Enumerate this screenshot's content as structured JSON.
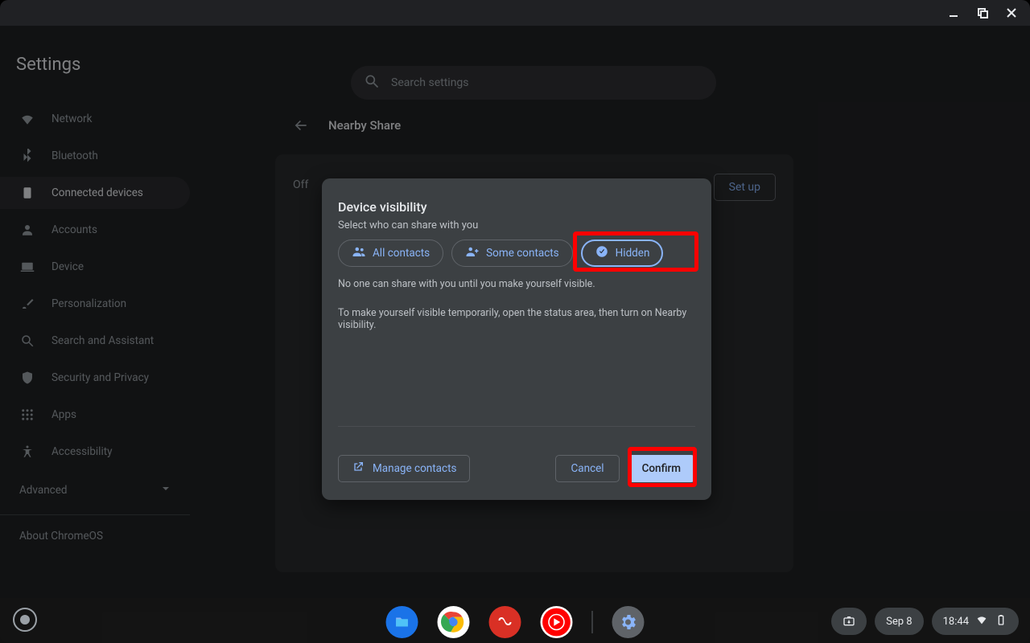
{
  "app_title": "Settings",
  "search": {
    "placeholder": "Search settings"
  },
  "sidebar": {
    "items": [
      {
        "label": "Network"
      },
      {
        "label": "Bluetooth"
      },
      {
        "label": "Connected devices"
      },
      {
        "label": "Accounts"
      },
      {
        "label": "Device"
      },
      {
        "label": "Personalization"
      },
      {
        "label": "Search and Assistant"
      },
      {
        "label": "Security and Privacy"
      },
      {
        "label": "Apps"
      },
      {
        "label": "Accessibility"
      }
    ],
    "advanced_label": "Advanced",
    "about_label": "About ChromeOS"
  },
  "page": {
    "title": "Nearby Share",
    "status_label": "Off",
    "setup_label": "Set up"
  },
  "dialog": {
    "title": "Device visibility",
    "subtitle": "Select who can share with you",
    "options": {
      "all": "All contacts",
      "some": "Some contacts",
      "hidden": "Hidden"
    },
    "msg1": "No one can share with you until you make yourself visible.",
    "msg2": "To make yourself visible temporarily, open the status area, then turn on Nearby visibility.",
    "manage_label": "Manage contacts",
    "cancel_label": "Cancel",
    "confirm_label": "Confirm"
  },
  "shelf": {
    "date": "Sep 8",
    "time": "18:44"
  }
}
